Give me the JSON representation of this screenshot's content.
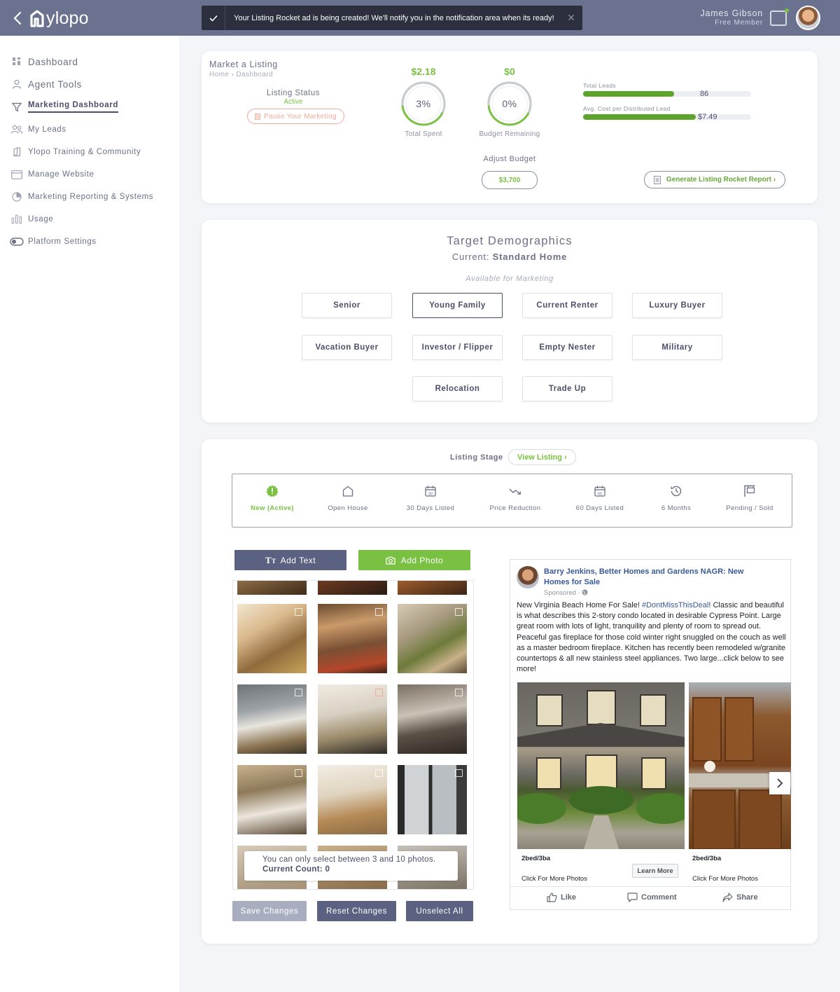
{
  "app": {
    "logo_text": "ylopo"
  },
  "toast": {
    "message": "Your Listing Rocket ad is being created! We'll notify you in the notification area when its ready!"
  },
  "user": {
    "name": "James Gibson",
    "role": "Free Member"
  },
  "sidebar": {
    "items": [
      {
        "label": "Dashboard",
        "icon": "grid-icon"
      },
      {
        "label": "Agent Tools",
        "icon": "user-icon"
      },
      {
        "label": "Marketing Dashboard",
        "icon": "funnel-icon"
      },
      {
        "label": "My Leads",
        "icon": "users-icon"
      },
      {
        "label": "Ylopo Training & Community",
        "icon": "book-icon"
      },
      {
        "label": "Manage Website",
        "icon": "browser-icon"
      },
      {
        "label": "Marketing Reporting & Systems",
        "icon": "pie-chart-icon"
      },
      {
        "label": "Usage",
        "icon": "bar-chart-icon"
      },
      {
        "label": "Platform Settings",
        "icon": "toggle-icon"
      }
    ]
  },
  "market": {
    "title": "Market a Listing",
    "breadcrumb": [
      "Home",
      "Dashboard"
    ],
    "breadcrumb_sep": "›",
    "status_label": "Listing Status",
    "status_value": "Active",
    "pause_label": "Pause Your Marketing",
    "total_spent": {
      "amount": "$2.18",
      "pct_text": "3%",
      "pct": 0.03,
      "label": "Total Spent"
    },
    "budget_remaining": {
      "amount": "$0",
      "pct_text": "0%",
      "pct": 0,
      "label": "Budget Remaining"
    },
    "bars": [
      {
        "label": "Total Leads",
        "value": "86",
        "fill": 0.54
      },
      {
        "label": "Avg. Cost per Distributed Lead",
        "value": "$7.49",
        "fill": 0.67
      }
    ],
    "adjust_label": "Adjust Budget",
    "budget_value": "$3,700",
    "report_label": "Generate Listing Rocket Report ›"
  },
  "demographics": {
    "title": "Target Demographics",
    "current_prefix": "Current:",
    "current_value": "Standard Home",
    "available_label": "Available for Marketing",
    "options": [
      "Senior",
      "Young Family",
      "Current Renter",
      "Luxury Buyer",
      "Vacation Buyer",
      "Investor / Flipper",
      "Empty Nester",
      "Military",
      "Relocation",
      "Trade Up"
    ],
    "selected": "Young Family"
  },
  "stage": {
    "label": "Listing Stage",
    "view_listing": "View Listing ›",
    "items": [
      {
        "label": "New (Active)",
        "icon": "alert-badge-icon",
        "active": true
      },
      {
        "label": "Open House",
        "icon": "house-icon"
      },
      {
        "label": "30 Days Listed",
        "icon": "calendar-30-icon"
      },
      {
        "label": "Price Reduction",
        "icon": "trend-down-icon"
      },
      {
        "label": "60 Days Listed",
        "icon": "calendar-60-icon"
      },
      {
        "label": "6 Months",
        "icon": "clock-icon"
      },
      {
        "label": "Pending / Sold",
        "icon": "sign-icon"
      }
    ],
    "cal_30": "30",
    "cal_60": "60"
  },
  "editor": {
    "add_text": "Add Text",
    "add_photo": "Add Photo",
    "note": "You can only select between 3 and 10 photos.",
    "count_label": "Current Count:",
    "count_value": "0",
    "save": "Save Changes",
    "reset": "Reset Changes",
    "unselect": "Unselect All"
  },
  "ad": {
    "page_name": "Barry Jenkins, Better Homes and Gardens NAGR: New Homes for Sale",
    "sponsored": "Sponsored ·",
    "headline": "New Virginia Beach Home For Sale!",
    "hashtag": "#DontMissThisDeal",
    "headline_end": "!",
    "body": "Classic and beautiful is what describes this 2-story condo located in desirable Cypress Point. Large great room with lots of light, tranquility and plenty of room to spread out. Peaceful gas fireplace for those cold winter right snuggled on the couch as well as a master bedroom fireplace. Kitchen has recently been remodeled w/granite countertops & all new stainless steel appliances. Two large...click below to see more!",
    "cards": [
      {
        "title": "2bed/3ba",
        "cta": "Click For More Photos"
      },
      {
        "title": "2bed/3ba",
        "cta": "Click For More Photos"
      }
    ],
    "learn_more": "Learn More",
    "like": "Like",
    "comment": "Comment",
    "share": "Share"
  },
  "colors": {
    "topbar": "#6b7290",
    "accent_green": "#7ac143",
    "dark_button": "#5b6180",
    "pause_red": "#f0a99a"
  }
}
